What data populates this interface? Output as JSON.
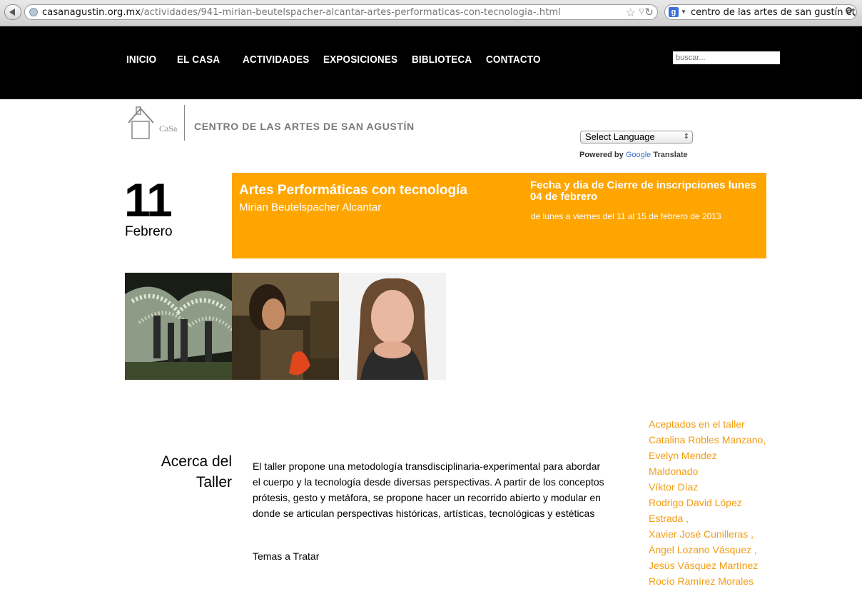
{
  "browser": {
    "url_host": "casanagustin.org.mx",
    "url_path": "/actividades/941-mirian-beutelspacher-alcantar-artes-performaticas-con-tecnologia-.html",
    "search_query": "centro de las artes de san gustín etla"
  },
  "nav": {
    "items": [
      "INICIO",
      "EL CASA",
      "ACTIVIDADES",
      "EXPOSICIONES",
      "BIBLIOTECA",
      "CONTACTO"
    ],
    "search_placeholder": "buscar..."
  },
  "header": {
    "logo_text": "CaSa",
    "org_name": "CENTRO DE LAS ARTES DE SAN AGUSTÍN",
    "language_select": "Select Language",
    "powered_by": "Powered by",
    "google": "Google",
    "translate": "Translate"
  },
  "event": {
    "day": "11",
    "month": "Febrero",
    "title": "Artes Performáticas con tecnología",
    "author": "Mirian Beutelspacher Alcantar",
    "deadline_label": "Fecha y dia de Cierre de inscripciones lunes 04 de febrero",
    "dates": "de lunes a viernes del 11 al 15 de febrero de 2013"
  },
  "content": {
    "heading": "Acerca del Taller",
    "body": "El taller propone una metodología transdisciplinaria-experimental para abordar el cuerpo y la tecnología desde diversas perspectivas. A partir de los conceptos prótesis, gesto y metáfora, se propone hacer un recorrido abierto y modular en donde se articulan perspectivas históricas, artísticas, tecnológicas y estéticas",
    "topics_label": "Temas a Tratar"
  },
  "accepted": {
    "lines": [
      "Aceptados en el taller",
      "Catalina Robles Manzano,",
      "Evelyn Mendez",
      "Maldonado",
      "Víktor Díaz",
      "Rodrigo David López",
      "Estrada ,",
      "Xavier José Cunilleras ,",
      "Ángel Lozano Vásquez ,",
      "Jesús Vásquez Martínez",
      "Rocío Ramírez Morales"
    ]
  },
  "colors": {
    "banner": "#ffa500",
    "accent_text": "#f39c12",
    "nav_bg": "#000000"
  }
}
